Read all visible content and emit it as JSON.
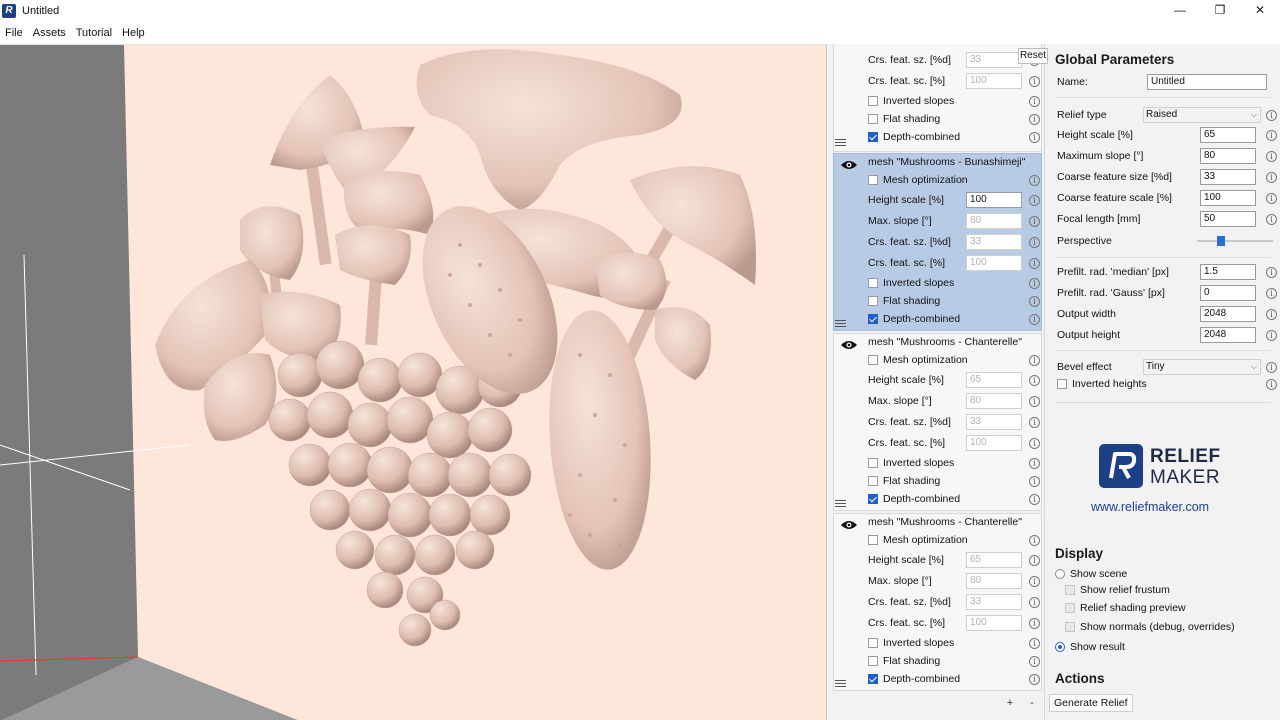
{
  "window": {
    "title": "Untitled",
    "minimize": "—",
    "maximize": "❐",
    "close": "✕",
    "app_icon": "R"
  },
  "menu": [
    "File",
    "Assets",
    "Tutorial",
    "Help"
  ],
  "tooltip": {
    "reset": "Reset"
  },
  "layers": {
    "first_partial": {
      "rows": [
        {
          "label": "Crs. feat. sz. [%d]",
          "value": "33",
          "disabled": true
        },
        {
          "label": "Crs. feat. sc. [%]",
          "value": "100",
          "disabled": true
        }
      ],
      "checks": [
        {
          "label": "Inverted slopes",
          "checked": false
        },
        {
          "label": "Flat shading",
          "checked": false
        },
        {
          "label": "Depth-combined",
          "checked": true
        }
      ]
    },
    "cards": [
      {
        "title": "mesh \"Mushrooms - Bunashimeji\"",
        "selected": true,
        "mesh_optimization": "Mesh optimization",
        "rows": [
          {
            "label": "Height scale [%]",
            "value": "100",
            "disabled": false
          },
          {
            "label": "Max. slope [°]",
            "value": "80",
            "disabled": true
          },
          {
            "label": "Crs. feat. sz. [%d]",
            "value": "33",
            "disabled": true
          },
          {
            "label": "Crs. feat. sc. [%]",
            "value": "100",
            "disabled": true
          }
        ],
        "checks": [
          {
            "label": "Inverted slopes",
            "checked": false
          },
          {
            "label": "Flat shading",
            "checked": false
          },
          {
            "label": "Depth-combined",
            "checked": true
          }
        ]
      },
      {
        "title": "mesh \"Mushrooms - Chanterelle\"",
        "selected": false,
        "mesh_optimization": "Mesh optimization",
        "rows": [
          {
            "label": "Height scale [%]",
            "value": "65",
            "disabled": true
          },
          {
            "label": "Max. slope [°]",
            "value": "80",
            "disabled": true
          },
          {
            "label": "Crs. feat. sz. [%d]",
            "value": "33",
            "disabled": true
          },
          {
            "label": "Crs. feat. sc. [%]",
            "value": "100",
            "disabled": true
          }
        ],
        "checks": [
          {
            "label": "Inverted slopes",
            "checked": false
          },
          {
            "label": "Flat shading",
            "checked": false
          },
          {
            "label": "Depth-combined",
            "checked": true
          }
        ]
      },
      {
        "title": "mesh \"Mushrooms - Chanterelle\"",
        "selected": false,
        "mesh_optimization": "Mesh optimization",
        "rows": [
          {
            "label": "Height scale [%]",
            "value": "65",
            "disabled": true
          },
          {
            "label": "Max. slope [°]",
            "value": "80",
            "disabled": true
          },
          {
            "label": "Crs. feat. sz. [%d]",
            "value": "33",
            "disabled": true
          },
          {
            "label": "Crs. feat. sc. [%]",
            "value": "100",
            "disabled": true
          }
        ],
        "checks": [
          {
            "label": "Inverted slopes",
            "checked": false
          },
          {
            "label": "Flat shading",
            "checked": false
          },
          {
            "label": "Depth-combined",
            "checked": true
          }
        ]
      }
    ],
    "add": "+",
    "remove": "-"
  },
  "global": {
    "heading": "Global Parameters",
    "name_label": "Name:",
    "name_value": "Untitled",
    "relief_type_label": "Relief type",
    "relief_type_value": "Raised",
    "params": [
      {
        "label": "Height scale [%]",
        "value": "65"
      },
      {
        "label": "Maximum slope [°]",
        "value": "80"
      },
      {
        "label": "Coarse feature size [%d]",
        "value": "33"
      },
      {
        "label": "Coarse feature scale [%]",
        "value": "100"
      },
      {
        "label": "Focal length [mm]",
        "value": "50"
      }
    ],
    "perspective_label": "Perspective",
    "perspective_level": 0.3,
    "prefilt": [
      {
        "label": "Prefilt. rad. 'median' [px]",
        "value": "1.5"
      },
      {
        "label": "Prefilt. rad. 'Gauss' [px]",
        "value": "0"
      },
      {
        "label": "Output width",
        "value": "2048"
      },
      {
        "label": "Output height",
        "value": "2048"
      }
    ],
    "bevel_label": "Bevel effect",
    "bevel_value": "Tiny",
    "inverted_heights": "Inverted heights"
  },
  "logo": {
    "line1": "RELIEF",
    "line2": "MAKER",
    "url": "www.reliefmaker.com"
  },
  "display": {
    "heading": "Display",
    "show_scene": "Show scene",
    "show_frustum": "Show relief frustum",
    "shading_preview": "Relief shading preview",
    "show_normals": "Show normals (debug, overrides)",
    "show_result": "Show result"
  },
  "actions": {
    "heading": "Actions",
    "generate": "Generate Relief"
  },
  "colors": {
    "accent": "#1f5fc7",
    "selection": "#b8cbe5",
    "viewport_bg": "#ffe6da",
    "mesh": "#e8cfc4",
    "brand": "#1c3f86"
  }
}
